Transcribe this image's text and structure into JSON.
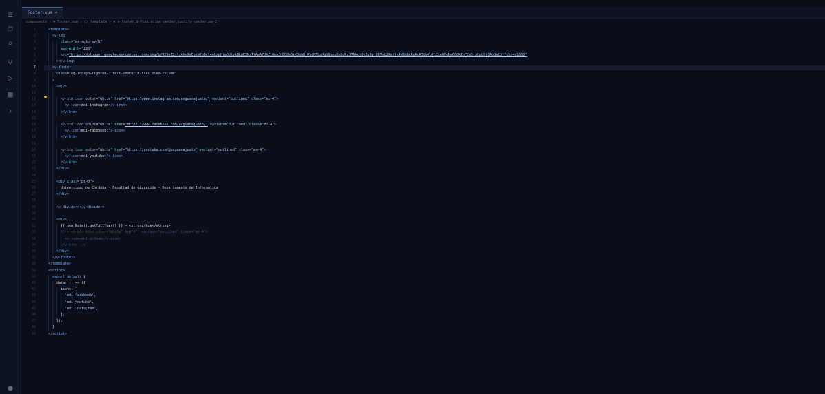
{
  "tab": {
    "label": "Footer.vue"
  },
  "breadcrumb": {
    "text": "components › ▼ Footer.vue › {} template › ▼ v-footer.d-flex.align-center.justify-center.pa-2"
  },
  "activity_icons": [
    "files-icon",
    "search-icon",
    "source-control-icon",
    "run-debug-icon",
    "extensions-icon",
    "remote-icon"
  ],
  "lines": [
    {
      "num": "1",
      "indent": 2,
      "html": "<span class=\"tag\">&lt;template&gt;</span>"
    },
    {
      "num": "2",
      "indent": 4,
      "html": "<span class=\"tag\">&lt;v-img</span>"
    },
    {
      "num": "3",
      "indent": 8,
      "html": "<span class=\"attr\">class</span>=<span class=\"str\">\"mx-auto my-6\"</span>"
    },
    {
      "num": "4",
      "indent": 8,
      "html": "<span class=\"attr\">max-width</span>=<span class=\"str\">\"228\"</span>"
    },
    {
      "num": "5",
      "indent": 8,
      "html": "<span class=\"attr\">src</span>=<span class=\"url\">\"https://blogger.googleusercontent.com/img/b/R29vZ2xl/AVvXsEgkWfbOcl4oUzpHjaOdlvkBLpE3NzTYAmA7UhZl0wxJnBQ8s3zK0ubDrRVcMFLuHgU8pmsKoLdRzJ7NhcjQz3u9p_Q8TmL2XsVjk4W8nBcRgKcR3dwYuf1ZxeOFvNm6G8kIoT2m5_zHpL9j8AbQwE3rYcVs=s1600\"</span>"
    },
    {
      "num": "6",
      "indent": 6,
      "html": "<span class=\"tag\">&gt;&lt;/v-img&gt;</span>"
    },
    {
      "num": "7",
      "indent": 4,
      "html": "<span class=\"tag\">&lt;v-footer</span>",
      "current": true
    },
    {
      "num": "8",
      "indent": 6,
      "html": "<span class=\"attr\">class</span>=<span class=\"str\">\"bg-indigo-lighten-1 text-center d-flex flex-column\"</span>"
    },
    {
      "num": "9",
      "indent": 4,
      "html": "<span class=\"tag\">&gt;</span>"
    },
    {
      "num": "10",
      "indent": 6,
      "html": "<span class=\"tag\">&lt;div&gt;</span>"
    },
    {
      "num": "11",
      "indent": 6,
      "html": ""
    },
    {
      "num": "12",
      "indent": 8,
      "html": "<span class=\"tag\">&lt;v-btn</span> <span class=\"attr\">icon</span> <span class=\"attr\">color</span>=<span class=\"str\">\"white\"</span> <span class=\"attr\">href</span>=<span class=\"url\">\"https://www.instagram.com/uvguanajuato/\"</span> <span class=\"attr\">variant</span>=<span class=\"str\">\"outlined\"</span> <span class=\"attr\">class</span>=<span class=\"str\">\"mx-4\"</span><span class=\"tag\">&gt;</span>"
    },
    {
      "num": "13",
      "indent": 10,
      "html": "<span class=\"tag\">&lt;v-icon&gt;</span><span class=\"txt\">mdi-instagram</span><span class=\"tag\">&lt;/v-icon&gt;</span>"
    },
    {
      "num": "14",
      "indent": 8,
      "html": "<span class=\"tag\">&lt;/v-btn&gt;</span>"
    },
    {
      "num": "15",
      "indent": 6,
      "html": ""
    },
    {
      "num": "16",
      "indent": 8,
      "html": "<span class=\"tag\">&lt;v-btn</span> <span class=\"attr\">icon</span> <span class=\"attr\">color</span>=<span class=\"str\">\"white\"</span> <span class=\"attr\">href</span>=<span class=\"url\">\"https://www.facebook.com/uvguanajuato/\"</span> <span class=\"attr\">variant</span>=<span class=\"str\">\"outlined\"</span> <span class=\"attr\">class</span>=<span class=\"str\">\"mx-4\"</span><span class=\"tag\">&gt;</span>"
    },
    {
      "num": "17",
      "indent": 10,
      "html": "<span class=\"tag\">&lt;v-icon&gt;</span><span class=\"txt\">mdi-facebook</span><span class=\"tag\">&lt;/v-icon&gt;</span>"
    },
    {
      "num": "18",
      "indent": 8,
      "html": "<span class=\"tag\">&lt;/v-btn&gt;</span>"
    },
    {
      "num": "19",
      "indent": 6,
      "html": ""
    },
    {
      "num": "20",
      "indent": 8,
      "html": "<span class=\"tag\">&lt;v-btn</span> <span class=\"attr\">icon</span> <span class=\"attr\">color</span>=<span class=\"str\">\"white\"</span> <span class=\"attr\">href</span>=<span class=\"url\">\"https://youtube.com/@uvguanajuato\"</span> <span class=\"attr\">variant</span>=<span class=\"str\">\"outlined\"</span> <span class=\"attr\">class</span>=<span class=\"str\">\"mx-4\"</span><span class=\"tag\">&gt;</span>"
    },
    {
      "num": "21",
      "indent": 10,
      "html": "<span class=\"tag\">&lt;v-icon&gt;</span><span class=\"txt\">mdi-youtube</span><span class=\"tag\">&lt;/v-icon&gt;</span>"
    },
    {
      "num": "22",
      "indent": 8,
      "html": "<span class=\"tag\">&lt;/v-btn&gt;</span>"
    },
    {
      "num": "23",
      "indent": 6,
      "html": "<span class=\"tag\">&lt;/div&gt;</span>"
    },
    {
      "num": "24",
      "indent": 6,
      "html": ""
    },
    {
      "num": "25",
      "indent": 6,
      "html": "<span class=\"tag\">&lt;div</span> <span class=\"attr\">class</span>=<span class=\"str\">\"pt-0\"</span><span class=\"tag\">&gt;</span>"
    },
    {
      "num": "26",
      "indent": 8,
      "html": "<span class=\"txt\">Universidad de Córdoba - Facultad de educación - Departamento de Informática</span>"
    },
    {
      "num": "27",
      "indent": 6,
      "html": "<span class=\"tag\">&lt;/div&gt;</span>"
    },
    {
      "num": "28",
      "indent": 6,
      "html": ""
    },
    {
      "num": "29",
      "indent": 6,
      "html": "<span class=\"tag\">&lt;v-divider&gt;&lt;/v-divider&gt;</span>"
    },
    {
      "num": "30",
      "indent": 6,
      "html": ""
    },
    {
      "num": "31",
      "indent": 6,
      "html": "<span class=\"tag\">&lt;div&gt;</span>"
    },
    {
      "num": "32",
      "indent": 8,
      "html": "<span class=\"txt\">{{ new Date().getFullYear() }} — &lt;strong&gt;Vue&lt;/strong&gt;</span>"
    },
    {
      "num": "33",
      "indent": 8,
      "html": "<span class=\"cmt\">&lt;!-- &lt;v-btn icon color=\"white\" href=\"\" variant=\"outlined\" class=\"mx-4\"&gt;</span>"
    },
    {
      "num": "34",
      "indent": 10,
      "html": "<span class=\"cmt\">&lt;v-icon&gt;mdi-github&lt;/v-icon&gt;</span>"
    },
    {
      "num": "35",
      "indent": 8,
      "html": "<span class=\"cmt\">&lt;/v-btn&gt; --&gt;</span>"
    },
    {
      "num": "36",
      "indent": 6,
      "html": "<span class=\"tag\">&lt;/div&gt;</span>"
    },
    {
      "num": "37",
      "indent": 4,
      "html": "<span class=\"tag\">&lt;/v-footer&gt;</span>"
    },
    {
      "num": "38",
      "indent": 2,
      "html": "<span class=\"tag\">&lt;/template&gt;</span>"
    },
    {
      "num": "39",
      "indent": 2,
      "html": "<span class=\"tag\">&lt;script&gt;</span>"
    },
    {
      "num": "40",
      "indent": 4,
      "html": "<span class=\"kw\">export default</span> <span class=\"txt\">{</span>"
    },
    {
      "num": "41",
      "indent": 6,
      "html": "<span class=\"txt\">data: () =&gt; ({</span>"
    },
    {
      "num": "42",
      "indent": 8,
      "html": "<span class=\"txt\">icons: [</span>"
    },
    {
      "num": "43",
      "indent": 10,
      "html": "<span class=\"str\">'mdi-facebook'</span><span class=\"txt\">,</span>"
    },
    {
      "num": "44",
      "indent": 10,
      "html": "<span class=\"str\">'mdi-youtube'</span><span class=\"txt\">,</span>"
    },
    {
      "num": "45",
      "indent": 10,
      "html": "<span class=\"str\">'mdi-instagram'</span><span class=\"txt\">,</span>"
    },
    {
      "num": "46",
      "indent": 8,
      "html": "<span class=\"txt\">],</span>"
    },
    {
      "num": "47",
      "indent": 6,
      "html": "<span class=\"txt\">}),</span>"
    },
    {
      "num": "48",
      "indent": 4,
      "html": "<span class=\"txt\">}</span>"
    },
    {
      "num": "49",
      "indent": 2,
      "html": "<span class=\"tag\">&lt;/script&gt;</span>"
    }
  ]
}
